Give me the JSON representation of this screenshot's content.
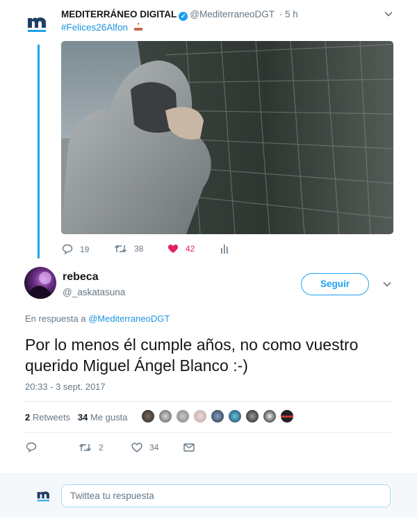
{
  "parent_tweet": {
    "author_name": "MEDITERRÁNEO DIGITAL",
    "handle": "@MediterraneoDGT",
    "time": "· 5 h",
    "hashtag": "#Felices26Alfon",
    "actions": {
      "replies": "19",
      "retweets": "38",
      "likes": "42"
    },
    "like_color": "#e0245e"
  },
  "reply_tweet": {
    "author_name": "rebeca",
    "handle": "@_askatasuna",
    "follow_label": "Seguir",
    "in_reply_prefix": "En respuesta a",
    "in_reply_handle": "@MediterraneoDGT",
    "text": "Por lo menos él cumple años, no como vuestro querido Miguel Ángel Blanco :-)",
    "timestamp": "20:33 - 3 sept. 2017",
    "stats": {
      "retweets_count": "2",
      "retweets_label": "Retweets",
      "likes_count": "34",
      "likes_label": "Me gusta"
    },
    "actions": {
      "replies": "",
      "retweets": "2",
      "likes": "34"
    }
  },
  "compose": {
    "placeholder": "Twittea tu respuesta"
  },
  "colors": {
    "accent": "#1da1f2",
    "link": "#1b95e0",
    "muted": "#657786",
    "brand": "#1f3f66"
  }
}
